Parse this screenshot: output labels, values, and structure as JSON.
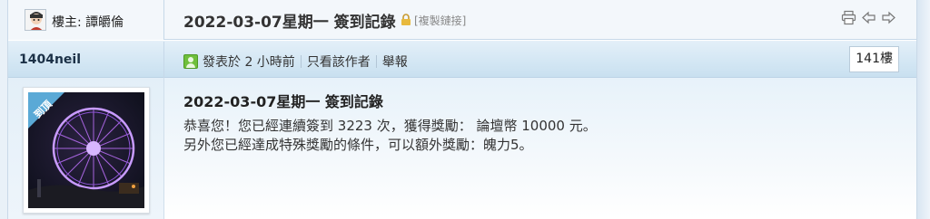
{
  "owner": {
    "label": "樓主: 譚皭倫",
    "avatar": "avatar-icon"
  },
  "thread": {
    "title": "2022-03-07星期一 簽到記錄",
    "copy_link": "[複製鏈接]",
    "tools": [
      "print-icon",
      "prev-arrow-icon",
      "next-arrow-icon"
    ]
  },
  "post": {
    "author": "1404neil",
    "posted": "發表於 2 小時前",
    "only_author": "只看該作者",
    "report": "舉報",
    "floor": "141樓",
    "title": "2022-03-07星期一 簽到記錄",
    "lines": [
      "恭喜您！您已經連續簽到 3223 次，獲得獎勵： 論壇幣 10000 元。",
      "另外您已經達成特殊獎勵的條件，可以額外獎勵：魄力5。"
    ],
    "avatar_badge": "到頂"
  },
  "colors": {
    "band": "#d4e7f4",
    "border": "#c6d8e9",
    "firework": "#b56cf0"
  }
}
